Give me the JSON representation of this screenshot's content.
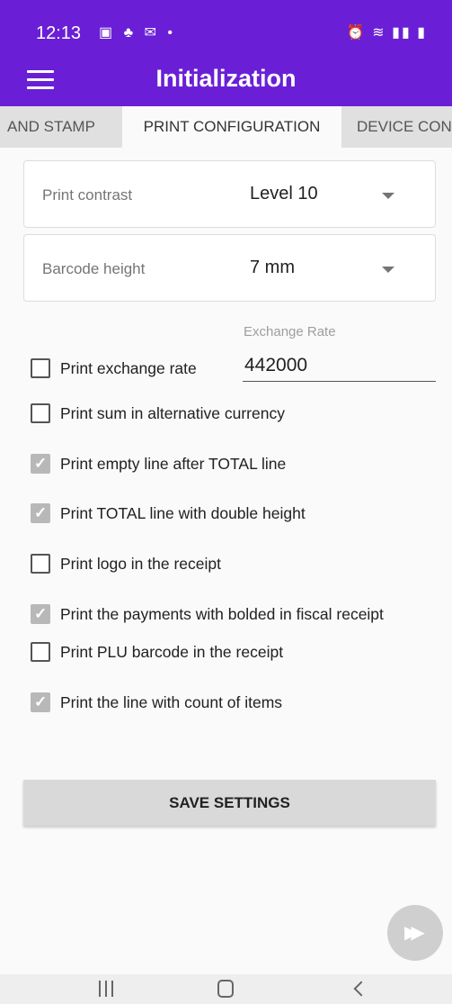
{
  "status_bar": {
    "time": "12:13",
    "left_icons": "▣ ♣ ✉ •",
    "right_icons": "⏰ ≋ ▮▮ ▮"
  },
  "app_bar": {
    "title": "Initialization",
    "menu_icon": "hamburger-menu"
  },
  "tabs": [
    {
      "label": "AND STAMP",
      "active": false
    },
    {
      "label": "PRINT CONFIGURATION",
      "active": true
    },
    {
      "label": "DEVICE CON",
      "active": false
    }
  ],
  "selects": {
    "print_contrast": {
      "label": "Print contrast",
      "value": "Level 10"
    },
    "barcode_height": {
      "label": "Barcode height",
      "value": "7 mm"
    }
  },
  "exchange_rate": {
    "label": "Exchange Rate",
    "value": "442000"
  },
  "options": [
    {
      "label": "Print exchange rate",
      "checked": false
    },
    {
      "label": "Print sum in alternative currency",
      "checked": false
    },
    {
      "label": "Print empty line after TOTAL line",
      "checked": true
    },
    {
      "label": "Print TOTAL line with double height",
      "checked": true
    },
    {
      "label": "Print logo in the receipt",
      "checked": false
    },
    {
      "label": "Print the payments with bolded in fiscal receipt",
      "checked": true
    },
    {
      "label": "Print PLU barcode in the receipt",
      "checked": false
    },
    {
      "label": "Print the line with count of items",
      "checked": true
    }
  ],
  "save_button": {
    "label": "SAVE SETTINGS"
  },
  "fab": {
    "icon": "fast-forward"
  },
  "nav_bar": {
    "recents": "III",
    "home": "O",
    "back": "<"
  },
  "colors": {
    "primary": "#6a1fd6",
    "background": "#fafafa",
    "checked_box": "#b8b8b8",
    "button": "#d9d9d9"
  }
}
